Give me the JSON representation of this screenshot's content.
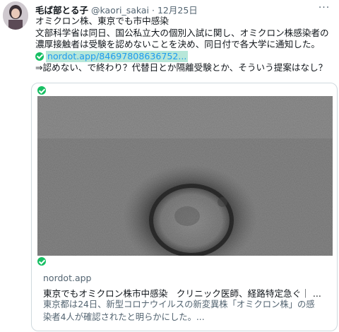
{
  "tweet": {
    "display_name": "毛ば部とる子",
    "handle": "@kaori_sakai",
    "separator": "·",
    "date": "12月25日",
    "more_label": "···",
    "body_lines": [
      "オミクロン株、東京でも市中感染",
      "文部科学省は同日、国公私立大の個別入試に関し、オミクロン株感染者の",
      "濃厚接触者は受験を認めないことを決め、同日付で各大学に通知した。"
    ],
    "link_text": "nordot.app/84697808636752...",
    "comment": "⇒認めない、で終わり？代替日とか隔離受験とか、そういう提案はなし？"
  },
  "card": {
    "domain": "nordot.app",
    "title": "東京でもオミクロン株市中感染　クリニック医師、経路特定急ぐ｜ ...",
    "description_lines": [
      "東京都は24日、新型コロナウイルスの新変異株「オミクロン株」の感",
      "染者4人が確認されたと明らかにした。..."
    ]
  },
  "icons": {
    "verified": "check-circle-icon",
    "more": "more-icon"
  },
  "colors": {
    "link_blue": "#1d9bf0",
    "link_highlight": "#b7e7d9",
    "check_green": "#17bf63",
    "secondary_text": "#536471"
  }
}
